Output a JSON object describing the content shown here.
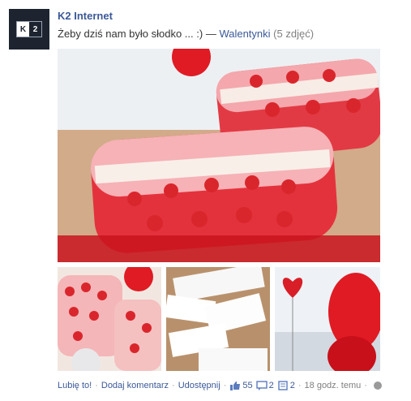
{
  "post": {
    "page_name": "K2 Internet",
    "avatar": {
      "logo_left": "K",
      "logo_right": "2"
    },
    "message": "Żeby dziś nam było słodko ... :)",
    "separator": "—",
    "album_name": "Walentynki",
    "photo_count": "(5 zdjęć)"
  },
  "actions": {
    "like": "Lubię to!",
    "comment": "Dodaj komentarz",
    "share": "Udostępnij",
    "likes_count": "55",
    "comments_count": "2",
    "shares_count": "2",
    "timestamp": "18 godz. temu",
    "separator": "·"
  },
  "icons": {
    "like": "thumbs-up-icon",
    "comment": "comment-icon",
    "share": "share-icon",
    "privacy": "globe-icon"
  },
  "colors": {
    "link": "#3b5998",
    "meta": "#808080",
    "heart_red": "#d9262c"
  }
}
